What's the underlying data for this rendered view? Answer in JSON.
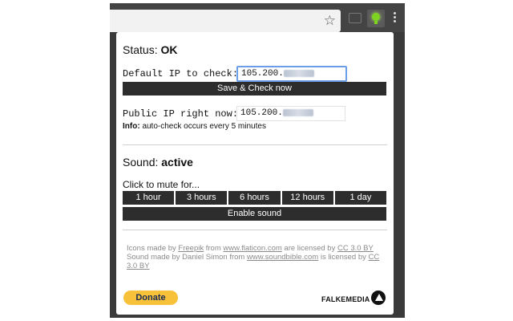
{
  "toolbar": {
    "star_icon": "star-icon",
    "cast_icon": "cast-icon",
    "extension_icon": "lightbulb-icon",
    "menu_icon": "more-vert-icon"
  },
  "status": {
    "label": "Status:",
    "value": "OK"
  },
  "default_ip": {
    "label": "Default IP to check:",
    "value_prefix": "105.200."
  },
  "save_button": "Save & Check now",
  "public_ip": {
    "label": "Public IP right now:",
    "value_prefix": "105.200."
  },
  "info": {
    "label": "Info:",
    "text": "auto-check occurs every 5 minutes"
  },
  "sound": {
    "label": "Sound:",
    "value": "active",
    "mute_prompt": "Click to mute for...",
    "mute_options": [
      "1 hour",
      "3 hours",
      "6 hours",
      "12 hours",
      "1 day"
    ],
    "enable_button": "Enable sound"
  },
  "credits": {
    "line1_a": "Icons made by ",
    "freepik": "Freepik",
    "line1_b": " from ",
    "flaticon": "www.flaticon.com",
    "line1_c": " are licensed by ",
    "cc1": "CC 3.0 BY",
    "line2_a": "Sound made by Daniel Simon from ",
    "soundbible": "www.soundbible.com",
    "line2_b": " is licensed by ",
    "cc2": "CC 3.0 BY"
  },
  "donate_button": "Donate",
  "logo_text": "FALKEMEDIA"
}
